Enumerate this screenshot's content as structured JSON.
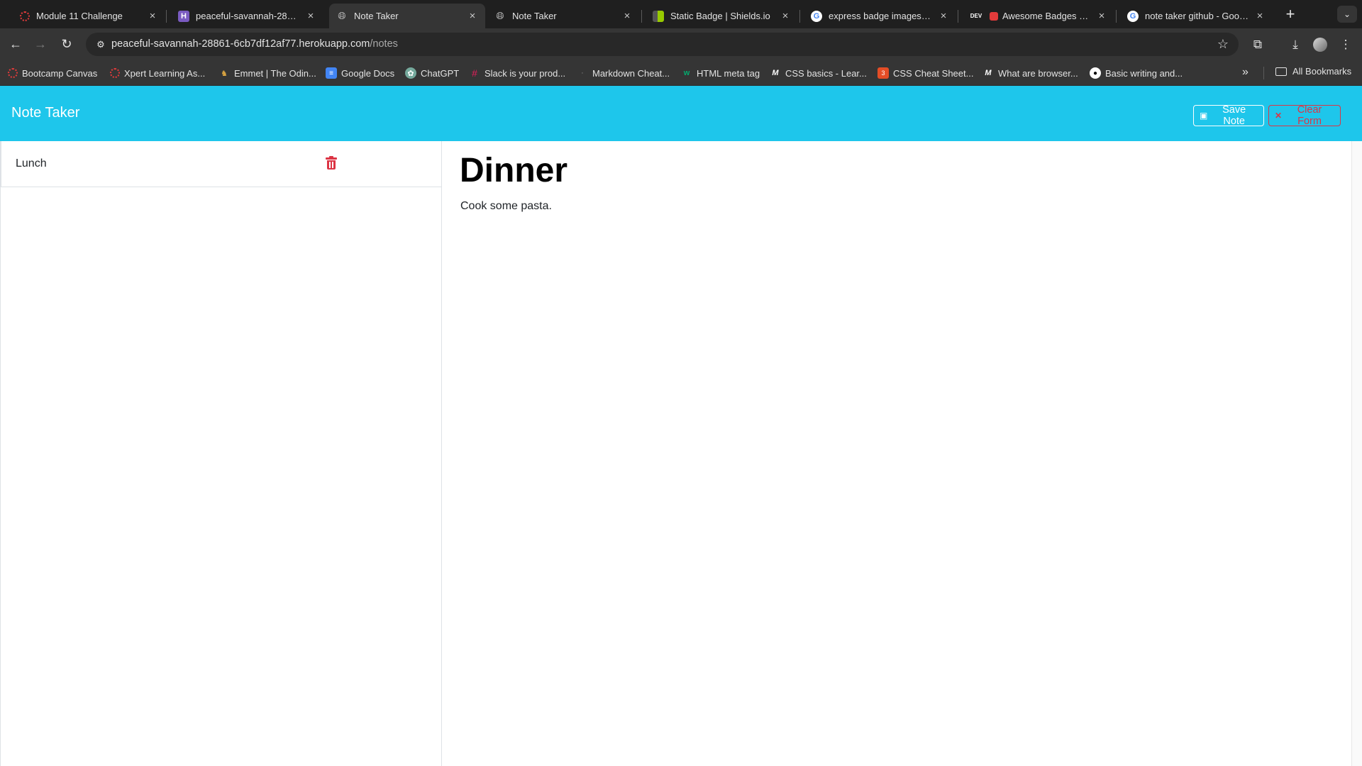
{
  "browser": {
    "tabs": [
      {
        "title": "Module 11 Challenge",
        "icon": "canvas-icon",
        "active": false
      },
      {
        "title": "peaceful-savannah-28861",
        "icon": "heroku-icon",
        "active": false
      },
      {
        "title": "Note Taker",
        "icon": "globe-icon",
        "active": true
      },
      {
        "title": "Note Taker",
        "icon": "globe-icon",
        "active": false
      },
      {
        "title": "Static Badge | Shields.io",
        "icon": "shields-icon",
        "active": false
      },
      {
        "title": "express badge imageshields",
        "icon": "google-icon",
        "active": false
      },
      {
        "title": "Awesome Badges - DEV",
        "icon": "dev-icon",
        "active": false
      },
      {
        "title": "note taker github - Google",
        "icon": "google-icon",
        "active": false
      }
    ],
    "address": {
      "host": "peaceful-savannah-28861-6cb7df12af77.herokuapp.com",
      "path": "/notes"
    },
    "bookmarks": [
      {
        "label": "Bootcamp Canvas",
        "icon": "canvas-icon"
      },
      {
        "label": "Xpert Learning As...",
        "icon": "canvas-icon"
      },
      {
        "label": "Emmet | The Odin...",
        "icon": "odin-icon"
      },
      {
        "label": "Google Docs",
        "icon": "docs-icon"
      },
      {
        "label": "ChatGPT",
        "icon": "chatgpt-icon"
      },
      {
        "label": "Slack is your prod...",
        "icon": "slack-icon"
      },
      {
        "label": "Markdown Cheat...",
        "icon": "markdown-icon"
      },
      {
        "label": "HTML meta tag",
        "icon": "w3-icon"
      },
      {
        "label": "CSS basics - Lear...",
        "icon": "mdn-icon"
      },
      {
        "label": "CSS Cheat Sheet...",
        "icon": "css-icon"
      },
      {
        "label": "What are browser...",
        "icon": "mdn-icon"
      },
      {
        "label": "Basic writing and...",
        "icon": "github-icon"
      }
    ],
    "all_bookmarks_label": "All Bookmarks"
  },
  "app": {
    "brand": "Note Taker",
    "save_label": "Save Note",
    "clear_label": "Clear Form",
    "notes": [
      {
        "title": "Lunch"
      }
    ],
    "active_note": {
      "title": "Dinner",
      "text": "Cook some pasta."
    }
  },
  "colors": {
    "navbar": "#1ec6eb",
    "danger": "#dc3545"
  }
}
